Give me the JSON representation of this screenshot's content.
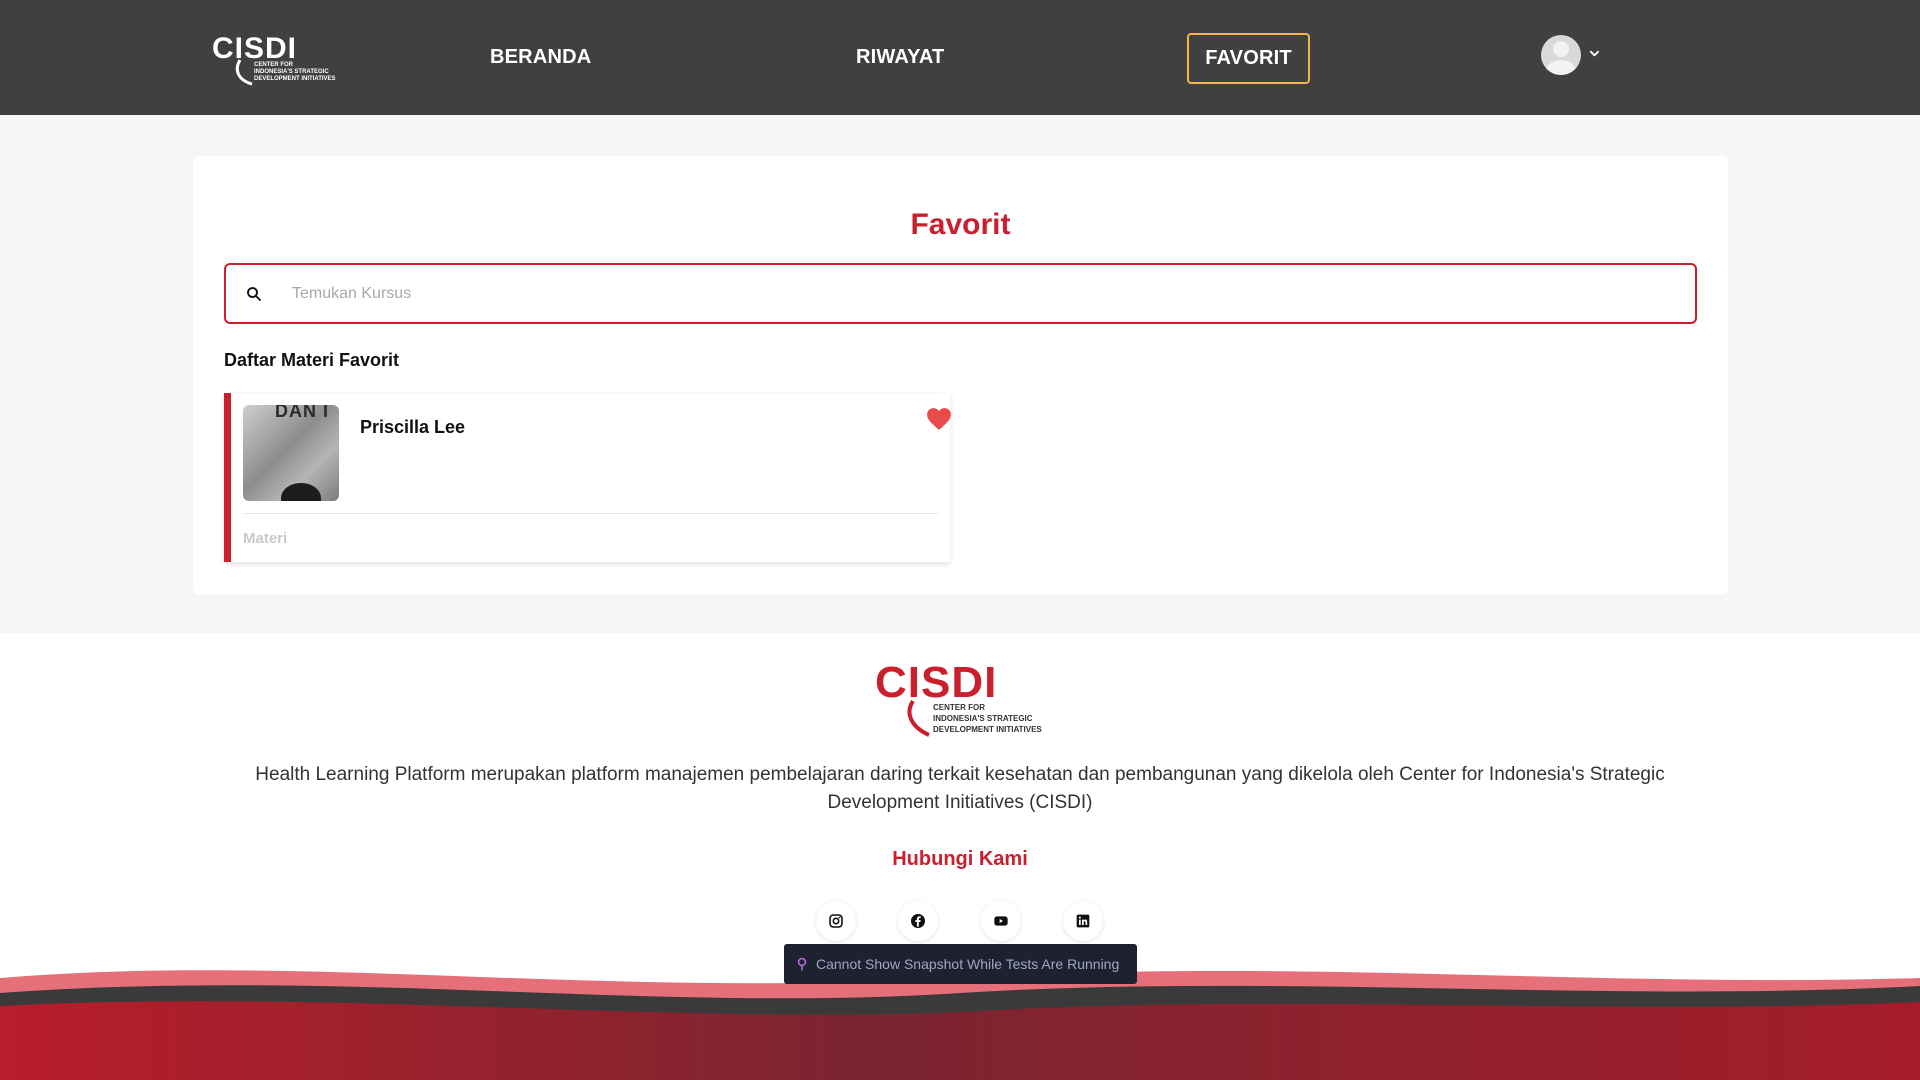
{
  "header": {
    "logo_word": "CISDI",
    "logo_subtext": [
      "CENTER FOR",
      "INDONESIA'S STRATEGIC",
      "DEVELOPMENT INITIATIVES"
    ],
    "nav": {
      "beranda": "BERANDA",
      "riwayat": "RIWAYAT",
      "favorit": "FAVORIT"
    },
    "active_nav": "favorit",
    "avatar_icon": "user-avatar-icon",
    "menu_icon": "chevron-down-icon"
  },
  "main": {
    "title": "Favorit",
    "search": {
      "placeholder": "Temukan Kursus",
      "value": ""
    },
    "section_label": "Daftar Materi Favorit",
    "favorites": [
      {
        "title": "Priscilla Lee",
        "thumbnail_text": "DAN I",
        "type": "Materi",
        "favorited": true
      }
    ]
  },
  "footer": {
    "logo_word": "CISDI",
    "logo_subtext": [
      "CENTER FOR",
      "INDONESIA'S STRATEGIC",
      "DEVELOPMENT INITIATIVES"
    ],
    "description": "Health Learning Platform merupakan platform manajemen pembelajaran daring terkait kesehatan dan pembangunan yang dikelola oleh Center for Indonesia's Strategic Development Initiatives (CISDI)",
    "contact_title": "Hubungi Kami",
    "social_icons": [
      "instagram-icon",
      "facebook-icon",
      "youtube-icon",
      "linkedin-icon"
    ]
  },
  "tooltip": {
    "text": "Cannot Show Snapshot While Tests Are Running",
    "icon": "pin-icon"
  },
  "colors": {
    "brand_red": "#cc1f2d",
    "nav_bg": "#404040",
    "active_border": "#f3b24a",
    "heart": "#e94b4b"
  }
}
